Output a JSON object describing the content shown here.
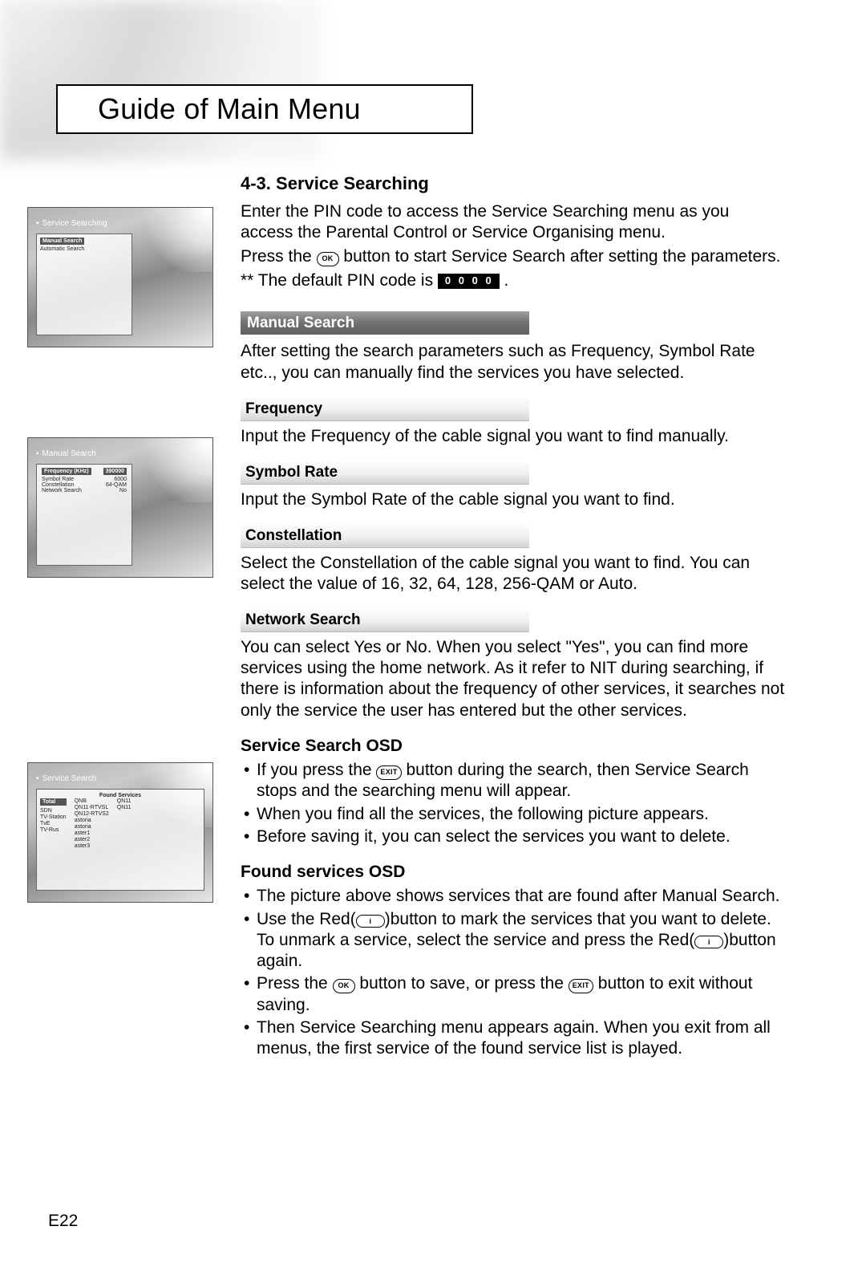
{
  "chapter_title": "Guide of Main Menu",
  "page_number": "E22",
  "buttons": {
    "ok": "OK",
    "exit": "EXIT",
    "i": "i"
  },
  "section": {
    "number": "4-3.",
    "title": "Service Searching",
    "intro_a": "Enter the PIN code to access the Service Searching menu as you access the Parental Control or Service Organising menu.",
    "intro_b_pre": "Press the ",
    "intro_b_post": " button to start Service Search after setting the parameters.",
    "pin_line_pre": "** The default PIN code is ",
    "pin_code": "0 0 0 0",
    "pin_line_post": " ."
  },
  "manual_search": {
    "header": "Manual Search",
    "text": "After setting the search parameters such as Frequency, Symbol Rate etc.., you can manually find the services you have selected."
  },
  "frequency": {
    "header": "Frequency",
    "text": "Input the Frequency of the cable signal you want to find manually."
  },
  "symbol_rate": {
    "header": "Symbol Rate",
    "text": "Input the Symbol Rate of the cable signal you want to find."
  },
  "constellation": {
    "header": "Constellation",
    "text": "Select the Constellation of the cable signal you want to find. You can select the value of 16, 32, 64, 128, 256-QAM or Auto."
  },
  "network_search": {
    "header": "Network Search",
    "text": "You can select Yes or No. When you select \"Yes\", you can find more services using the home network. As it refer to NIT during searching, if there is information about the frequency of other services, it searches not only the service the user has entered but the other services."
  },
  "service_search_osd": {
    "header": "Service Search OSD",
    "b1_pre": "If you press the ",
    "b1_post": " button during the search, then Service Search stops and the searching menu will appear.",
    "b2": "When you find all the services, the following picture appears.",
    "b3": "Before saving it, you can select the services you want to delete."
  },
  "found_services_osd": {
    "header": "Found services OSD",
    "b1": "The picture above shows services that are found after Manual Search.",
    "b2_pre": "Use the Red(",
    "b2_post": ")button to mark the services that you want to delete.",
    "b2_line2_pre": "To unmark a service, select the service and press the Red(",
    "b2_line2_post": ")button again.",
    "b3_a": "Press the ",
    "b3_b": " button to save, or press the ",
    "b3_c": " button to exit without saving.",
    "b4": "Then Service Searching menu appears again. When you exit from all menus, the first service of the found service list is played."
  },
  "thumbs": {
    "t1_title": "Service Searching",
    "t1_items": [
      "Manual Search",
      "Automatic Search"
    ],
    "t2_title": "Manual Search",
    "t2_rows": [
      [
        "Frequency (KHz)",
        "390000"
      ],
      [
        "Symbol Rate",
        "6000"
      ],
      [
        "Constellation",
        "64-QAM"
      ],
      [
        "Network Search",
        "No"
      ]
    ],
    "t3_title": "Service Search",
    "t3_header": "Found Services",
    "t3_left": [
      "Total",
      "SDN",
      "TV-Station",
      "TvE",
      "TV-Rus"
    ],
    "t3_mid": [
      "QNB",
      "QN11-RTVSL",
      "QN12-RTVS2",
      "astoria",
      "astoria",
      "aster1",
      "aster2",
      "aster3"
    ],
    "t3_right": [
      "QN11",
      "QN11"
    ]
  }
}
